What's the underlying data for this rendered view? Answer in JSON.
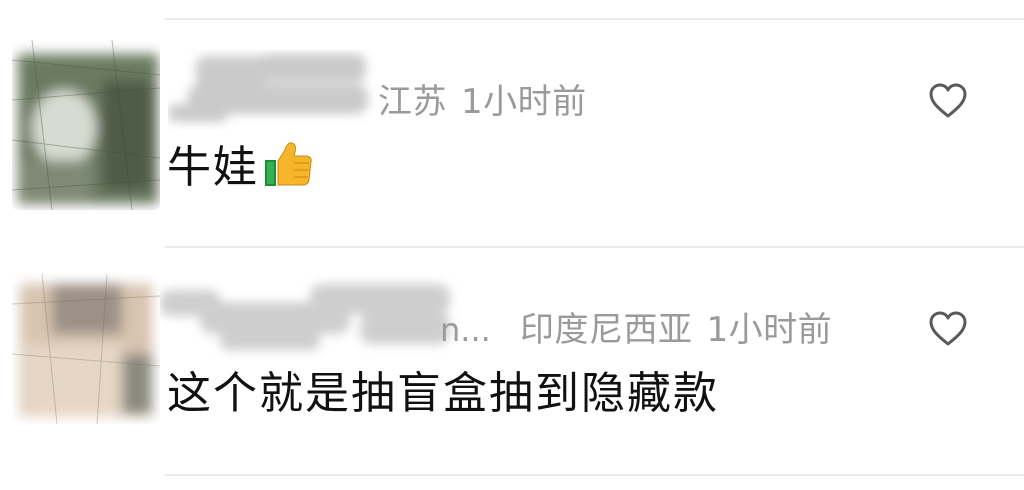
{
  "comments": [
    {
      "location": "江苏",
      "time": "1小时前",
      "text": "牛娃",
      "emoji_icon": "thumbs-up-icon",
      "avatar_colors": [
        "#5f6f55",
        "#c9d0c4",
        "#8a9480"
      ]
    },
    {
      "username_suffix": "n...",
      "location": "印度尼西亚",
      "time": "1小时前",
      "text": "这个就是抽盲盒抽到隐藏款",
      "avatar_colors": [
        "#cdb6a0",
        "#e2d3c3",
        "#7c7a72"
      ]
    }
  ],
  "like_icon": "heart-outline-icon",
  "colors": {
    "meta_text": "#9a9a9a",
    "body_text": "#111111",
    "divider": "#ececec"
  }
}
